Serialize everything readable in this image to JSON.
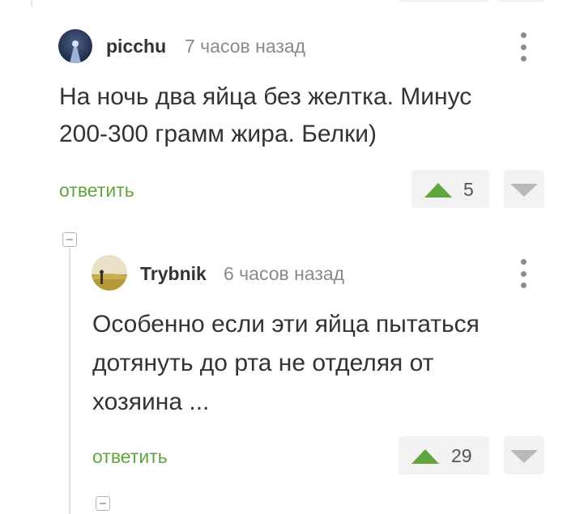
{
  "comments": [
    {
      "username": "picchu",
      "time": "7 часов назад",
      "text_lines": [
        "На ночь два яйца без желтка. Минус",
        "200-300 грамм жира. Белки)"
      ],
      "reply_label": "ответить",
      "rating": "5"
    },
    {
      "username": "Trybnik",
      "time": "6 часов назад",
      "text_lines": [
        "Особенно если эти яйца пытаться",
        "дотянуть до рта не отделяя от",
        "хозяина ..."
      ],
      "reply_label": "ответить",
      "rating": "29"
    }
  ],
  "colors": {
    "accent_green": "#61a53f",
    "rating_bg": "#f2f2f2",
    "downvote_gray": "#b9b9b9"
  },
  "icons": {
    "upvote": "triangle-up-icon",
    "downvote": "triangle-down-icon",
    "more": "kebab-menu-icon",
    "collapse": "collapse-minus-icon"
  }
}
